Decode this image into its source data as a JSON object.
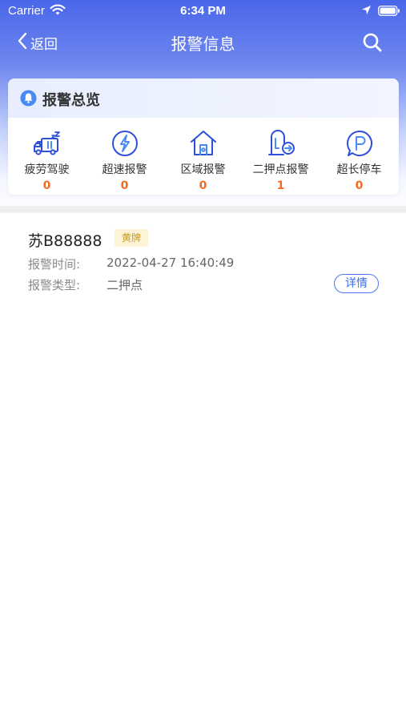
{
  "status_bar": {
    "carrier": "Carrier",
    "time": "6:34 PM"
  },
  "nav": {
    "back_label": "返回",
    "title": "报警信息"
  },
  "overview": {
    "title": "报警总览",
    "items": [
      {
        "label": "疲劳驾驶",
        "count": "0",
        "icon": "fatigue-truck-icon"
      },
      {
        "label": "超速报警",
        "count": "0",
        "icon": "speed-bolt-icon"
      },
      {
        "label": "区域报警",
        "count": "0",
        "icon": "area-house-icon"
      },
      {
        "label": "二押点报警",
        "count": "1",
        "icon": "secondary-pledge-icon"
      },
      {
        "label": "超长停车",
        "count": "0",
        "icon": "parking-icon"
      }
    ]
  },
  "records": [
    {
      "plate": "苏B88888",
      "plate_type": "黄牌",
      "time_label": "报警时间:",
      "time_value": "2022-04-27 16:40:49",
      "type_label": "报警类型:",
      "type_value": "二押点",
      "detail_label": "详情"
    }
  ],
  "colors": {
    "brand": "#4a67ea",
    "count": "#f26b21",
    "detail_border": "#4a78ee",
    "badge_bg": "#fdf4d6",
    "badge_text": "#c99a1f"
  }
}
